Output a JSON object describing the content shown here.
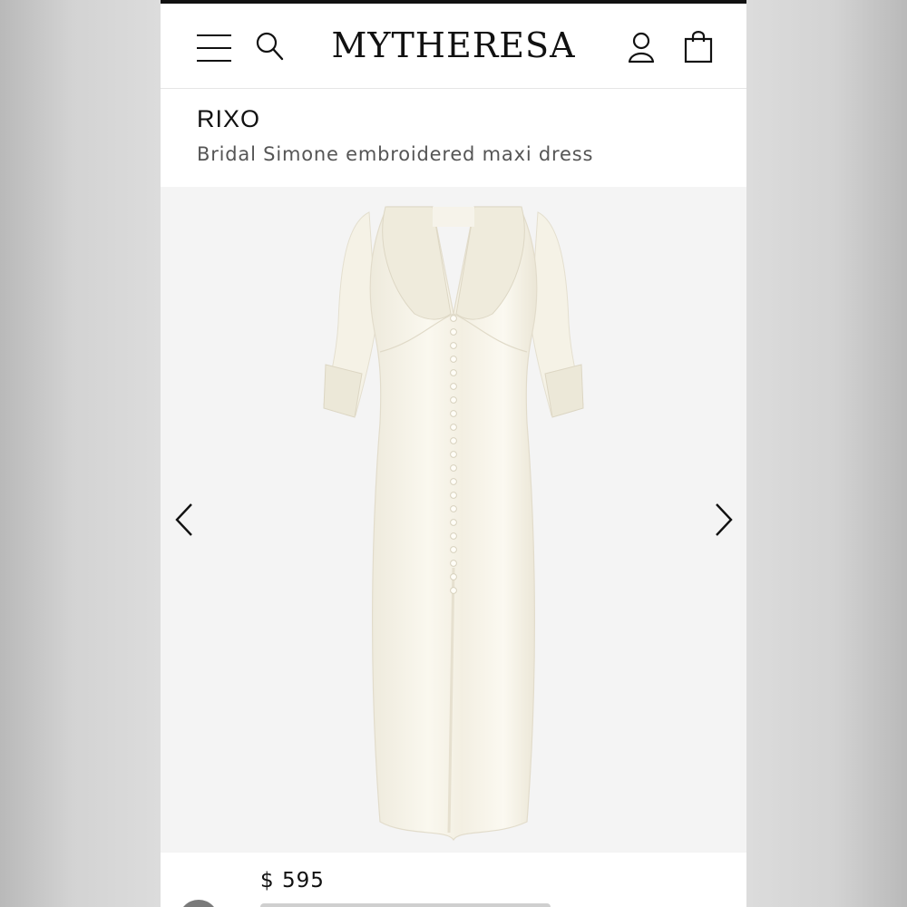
{
  "header": {
    "logo": "MYTHERESA",
    "menu_icon": "hamburger-menu-icon",
    "search_icon": "search-icon",
    "account_icon": "user-account-icon",
    "bag_icon": "shopping-bag-icon"
  },
  "product": {
    "brand": "RIXO",
    "name": "Bridal Simone embroidered maxi dress",
    "price": "$ 595"
  },
  "gallery": {
    "prev_icon": "chevron-left-icon",
    "next_icon": "chevron-right-icon",
    "image": "ivory-maxi-dress-image"
  },
  "colors": {
    "background": "#f4f4f4",
    "dress": "#f8f5ea",
    "text": "#111111"
  }
}
